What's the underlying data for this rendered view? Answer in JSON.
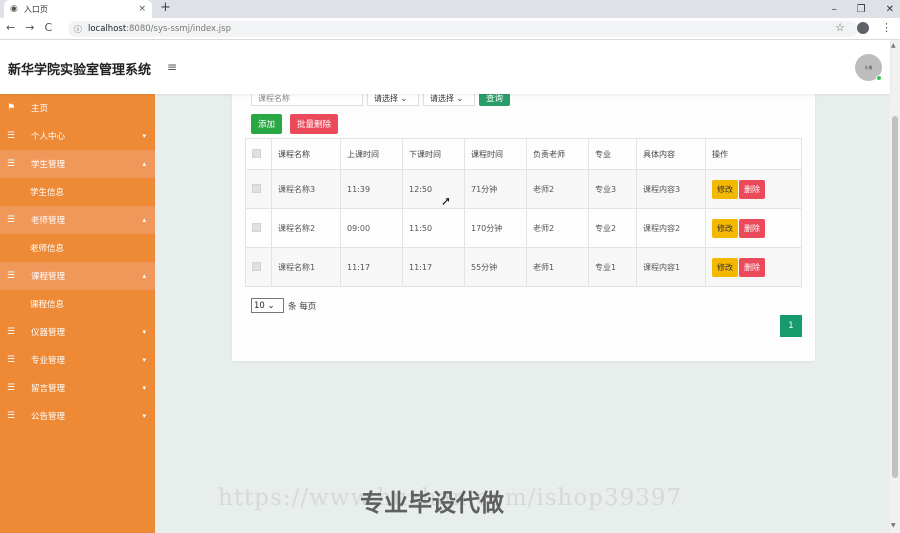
{
  "browser": {
    "tab_title": "入口页",
    "tab_close": "×",
    "new_tab": "+",
    "window_controls": [
      "–",
      "❐",
      "✕"
    ],
    "nav": [
      "←",
      "→",
      "C"
    ],
    "url_host": "localhost",
    "url_path": ":8080/sys-ssmj/index.jsp",
    "right_icons": [
      "☆",
      "⋮"
    ]
  },
  "header": {
    "title": "新华学院实验室管理系统",
    "menu_icon": "≡",
    "avatar_text": "头像"
  },
  "sidebar": {
    "items": [
      {
        "label": "主页",
        "icon": "flag-icon",
        "glyph": "⚑",
        "arrow": ""
      },
      {
        "label": "个人中心",
        "icon": "list-icon",
        "glyph": "☰",
        "arrow": "▾"
      },
      {
        "label": "学生管理",
        "icon": "list-icon",
        "glyph": "☰",
        "arrow": "▴",
        "open": true
      },
      {
        "label": "学生信息",
        "sub": true
      },
      {
        "label": "老师管理",
        "icon": "list-icon",
        "glyph": "☰",
        "arrow": "▴",
        "open": true
      },
      {
        "label": "老师信息",
        "sub": true
      },
      {
        "label": "课程管理",
        "icon": "list-icon",
        "glyph": "☰",
        "arrow": "▴",
        "open": true
      },
      {
        "label": "课程信息",
        "sub": true
      },
      {
        "label": "仪器管理",
        "icon": "list-icon",
        "glyph": "☰",
        "arrow": "▾"
      },
      {
        "label": "专业管理",
        "icon": "list-icon",
        "glyph": "☰",
        "arrow": "▾"
      },
      {
        "label": "留言管理",
        "icon": "list-icon",
        "glyph": "☰",
        "arrow": "▾"
      },
      {
        "label": "公告管理",
        "icon": "list-icon",
        "glyph": "☰",
        "arrow": "▾"
      }
    ]
  },
  "search": {
    "name_placeholder": "课程名称",
    "select1": "请选择",
    "select2": "请选择",
    "search_label": "查询",
    "add_label": "添加",
    "batch_delete_label": "批量删除"
  },
  "table": {
    "headers": [
      "",
      "课程名称",
      "上课时间",
      "下课时间",
      "课程时间",
      "负责老师",
      "专业",
      "具体内容",
      "操作"
    ],
    "rows": [
      [
        "课程名称3",
        "11:39",
        "12:50",
        "71分钟",
        "老师2",
        "专业3",
        "课程内容3"
      ],
      [
        "课程名称2",
        "09:00",
        "11:50",
        "170分钟",
        "老师2",
        "专业2",
        "课程内容2"
      ],
      [
        "课程名称1",
        "11:17",
        "11:17",
        "55分钟",
        "老师1",
        "专业1",
        "课程内容1"
      ]
    ],
    "edit_label": "修改",
    "delete_label": "删除"
  },
  "pagination": {
    "page_size": "10",
    "page_size_suffix": "条 每页",
    "current_page": "1"
  },
  "watermark": {
    "url_text": "https://www.huzhan.com/ishop39397",
    "overlay_text": "专业毕设代做"
  }
}
